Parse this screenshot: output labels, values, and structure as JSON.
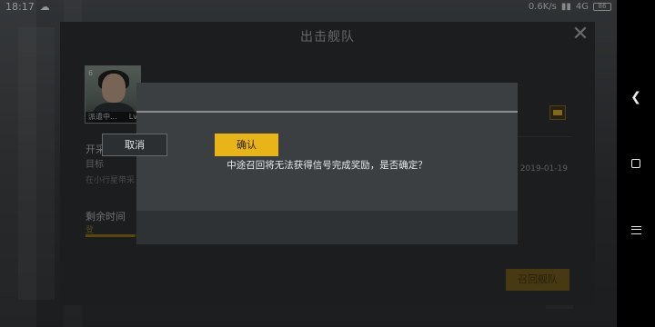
{
  "status_bar": {
    "time": "18:17",
    "cloud_icon": "cloud-icon",
    "network_speed": "0.6K/s",
    "network_type": "4G",
    "battery": "86"
  },
  "fleet_panel": {
    "title": "出击舰队",
    "portrait_tag": "派遣中...",
    "portrait_level": "Lv",
    "portrait_corner": "6",
    "mission_name": "开采陨石",
    "mission_target": "目标",
    "mission_desc": "在小行星带采",
    "time_label": "剩余时间",
    "time_value": "登",
    "time_progress": 0.45,
    "date": "2019-01-19",
    "recall_button": "召回舰队"
  },
  "dialog": {
    "message": "中途召回将无法获得信号完成奖励，是否确定？",
    "cancel_label": "取消",
    "confirm_label": "确认"
  },
  "colors": {
    "accent": "#e8b418",
    "panel": "#2b2d2f",
    "dialog": "#3c3f42"
  }
}
